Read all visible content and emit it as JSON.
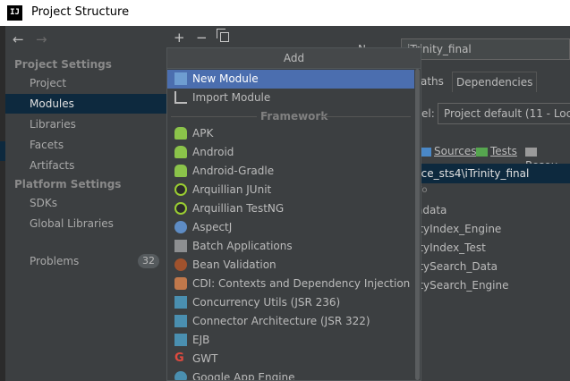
{
  "window": {
    "title": "Project Structure",
    "app_icon": "IJ"
  },
  "sidebar": {
    "nav_back": "←",
    "nav_forward": "→",
    "header_project": "Project Settings",
    "project_items": [
      "Project",
      "Modules",
      "Libraries",
      "Facets",
      "Artifacts"
    ],
    "header_platform": "Platform Settings",
    "platform_items": [
      "SDKs",
      "Global Libraries"
    ],
    "problems_label": "Problems",
    "problems_count": "32",
    "selected": "Modules"
  },
  "toolbar": {
    "add": "+",
    "remove": "−"
  },
  "popup": {
    "title": "Add",
    "top_items": [
      "New Module",
      "Import Module"
    ],
    "framework_label": "Framework",
    "framework_items": [
      "APK",
      "Android",
      "Android-Gradle",
      "Arquillian JUnit",
      "Arquillian TestNG",
      "AspectJ",
      "Batch Applications",
      "Bean Validation",
      "CDI: Contexts and Dependency Injection",
      "Concurrency Utils (JSR 236)",
      "Connector Architecture (JSR 322)",
      "EJB",
      "GWT",
      "Google App Engine"
    ],
    "selected": "New Module"
  },
  "right_panel": {
    "name_label": "N",
    "name_value": "iTrinity_final",
    "tabs": [
      "aths",
      "Dependencies"
    ],
    "sdk_label": "el:",
    "sdk_value": "Project default (11 - Local",
    "sources": [
      "Sources",
      "Tests",
      "Resou"
    ],
    "content_root": "rce_sts4\\iTrinity_final",
    "tree_items": [
      "adata",
      "ityIndex_Engine",
      "ityIndex_Test",
      "itySearch_Data",
      "itySearch_Engine"
    ],
    "tree_marker": "Fo"
  },
  "colors": {
    "selection": "#0d293e",
    "popup_selection": "#4b6eaf",
    "background": "#3c3f41"
  }
}
